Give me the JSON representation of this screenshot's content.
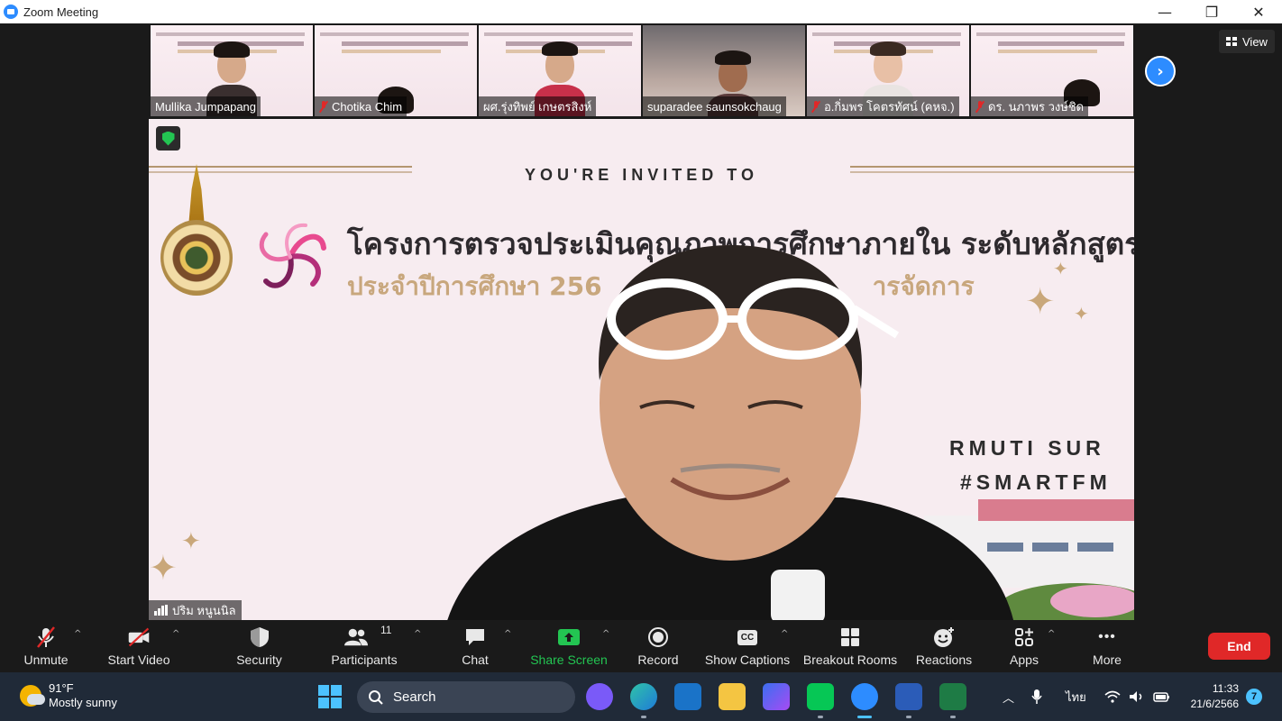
{
  "window": {
    "title": "Zoom Meeting",
    "minimize": "—",
    "restore": "❐",
    "close": "✕"
  },
  "view_button": {
    "label": "View"
  },
  "next_page_icon": "›",
  "participants_strip": [
    {
      "name": "Mullika Jumpapang",
      "muted": false
    },
    {
      "name": "Chotika Chim",
      "muted": true
    },
    {
      "name": "ผศ.รุ่งทิพย์ เกษตรสิงห์",
      "muted": false
    },
    {
      "name": "suparadee saunsokchaug",
      "muted": false
    },
    {
      "name": "อ.กิ่มพร โคตรทัศน์ (คหจ.)",
      "muted": true
    },
    {
      "name": "ดร. นภาพร วงษ์ชิด",
      "muted": true
    }
  ],
  "slide": {
    "invite": "YOU'RE INVITED TO",
    "title_th": "โครงการตรวจประเมินคุณภาพการศึกษาภายใน ระดับหลักสูตร",
    "subtitle_th": "ประจำปีการศึกษา 256",
    "subtitle_th_tail": "ารจัดการ",
    "rmuti": "RMUTI SUR",
    "hashtag": "#SMARTFM"
  },
  "speaker": {
    "name": "ปริม หนูนนิล"
  },
  "toolbar": {
    "unmute": "Unmute",
    "start_video": "Start Video",
    "security": "Security",
    "participants": "Participants",
    "participants_count": "11",
    "chat": "Chat",
    "share_screen": "Share Screen",
    "record": "Record",
    "captions": "Show Captions",
    "captions_icon": "CC",
    "breakout": "Breakout Rooms",
    "reactions": "Reactions",
    "apps": "Apps",
    "more": "More",
    "more_icon": "•••",
    "end": "End",
    "caret": "^"
  },
  "taskbar": {
    "temperature": "91°F",
    "weather": "Mostly sunny",
    "search": "Search",
    "language": "ไทย",
    "time": "11:33",
    "date": "21/6/2566",
    "notifications": "7"
  },
  "colors": {
    "zoom_blue": "#2d8cff",
    "end_red": "#e02828",
    "share_green": "#23c552",
    "taskbar": "#202a38"
  }
}
